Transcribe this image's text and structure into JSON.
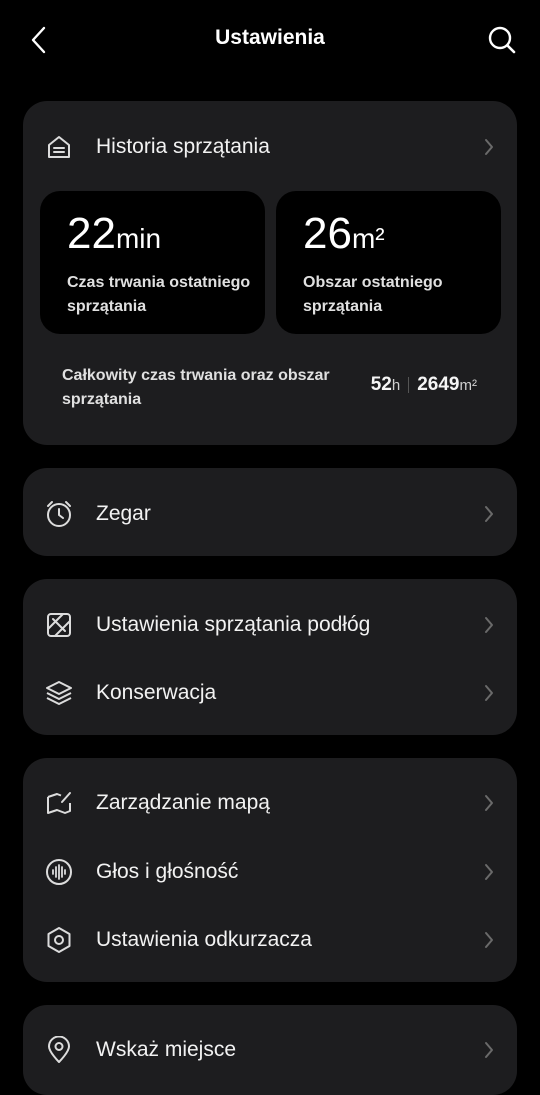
{
  "header": {
    "title": "Ustawienia",
    "back_icon": "chevron-left-icon",
    "search_icon": "search-icon"
  },
  "history": {
    "label": "Historia sprzątania",
    "last_duration": {
      "value": "22",
      "unit": "min",
      "label": "Czas trwania ostatniego sprzątania"
    },
    "last_area": {
      "value": "26",
      "unit": "m²",
      "label": "Obszar ostatniego sprzątania"
    },
    "total": {
      "label": "Całkowity czas trwania oraz obszar sprzątania",
      "hours": "52",
      "hours_unit": "h",
      "area": "2649",
      "area_unit": "m²"
    }
  },
  "items": {
    "clock": "Zegar",
    "floor": "Ustawienia sprzątania podłóg",
    "maintenance": "Konserwacja",
    "map": "Zarządzanie mapą",
    "voice": "Głos i głośność",
    "vacuum": "Ustawienia odkurzacza",
    "locate": "Wskaż miejsce"
  },
  "colors": {
    "background": "#000000",
    "card": "#1d1d1f",
    "text": "#ffffff",
    "chevron": "#6a6a6a"
  }
}
